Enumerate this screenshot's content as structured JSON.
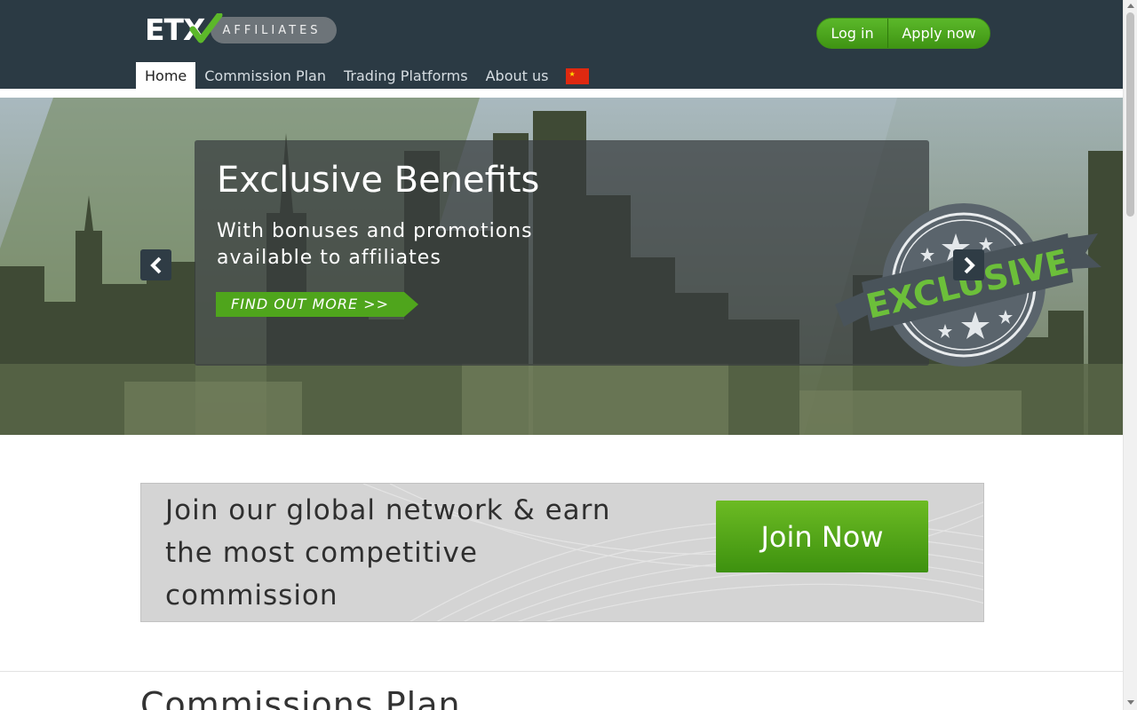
{
  "logo": {
    "main": "ETX",
    "tag": "AFFILIATES"
  },
  "auth": {
    "login": "Log in",
    "apply": "Apply now"
  },
  "nav": {
    "items": [
      {
        "label": "Home",
        "active": true
      },
      {
        "label": "Commission Plan",
        "active": false
      },
      {
        "label": "Trading Platforms",
        "active": false
      },
      {
        "label": "About us",
        "active": false
      }
    ],
    "flag": "china-flag-icon"
  },
  "hero": {
    "title": "Exclusive Benefits",
    "subtitle": "With bonuses and promotions available to affiliates",
    "cta": "FIND OUT MORE >>",
    "seal_text": "EXCLUSIVE",
    "prev_icon": "chevron-left-icon",
    "next_icon": "chevron-right-icon"
  },
  "join": {
    "text": "Join our global network & earn the most competitive commission",
    "button": "Join Now"
  },
  "section": {
    "title": "Commissions Plan"
  },
  "colors": {
    "header": "#2b3a44",
    "accent_green": "#4aa31b",
    "banner_grey": "#d4d4d4"
  }
}
